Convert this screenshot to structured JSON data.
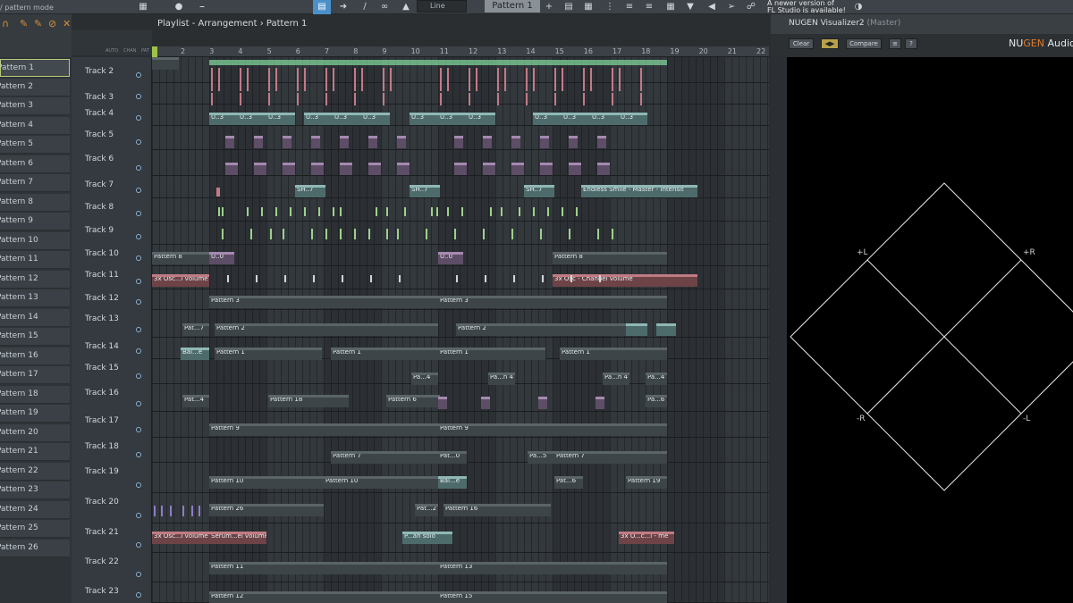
{
  "toolbar": {
    "hint": "/ pattern mode",
    "line_label": "Line",
    "pattern_selector": "Pattern 1",
    "news_line1": "A newer version of",
    "news_line2": "FL Studio is available!"
  },
  "pattern_list": [
    "Pattern 1",
    "Pattern 2",
    "Pattern 3",
    "Pattern 4",
    "Pattern 5",
    "Pattern 6",
    "Pattern 7",
    "Pattern 8",
    "Pattern 9",
    "Pattern 10",
    "Pattern 11",
    "Pattern 12",
    "Pattern 13",
    "Pattern 14",
    "Pattern 15",
    "Pattern 16",
    "Pattern 17",
    "Pattern 18",
    "Pattern 19",
    "Pattern 20",
    "Pattern 21",
    "Pattern 22",
    "Pattern 23",
    "Pattern 24",
    "Pattern 25",
    "Pattern 26"
  ],
  "playlist": {
    "title": "Playlist - Arrangement › Pattern 1",
    "tool_labels": [
      "AUTO",
      "CHAN",
      "PAT"
    ],
    "ruler": [
      "2",
      "3",
      "4",
      "5",
      "6",
      "7",
      "8",
      "9",
      "10",
      "11",
      "12",
      "13",
      "14",
      "15",
      "16",
      "17",
      "18",
      "19",
      "20",
      "21",
      "22"
    ],
    "tracks": [
      "Track 2",
      "Track 3",
      "Track 4",
      "Track 5",
      "Track 6",
      "Track 7",
      "Track 8",
      "Track 9",
      "Track 10",
      "Track 11",
      "Track 12",
      "Track 13",
      "Track 14",
      "Track 15",
      "Track 16",
      "Track 17",
      "Track 18",
      "Track 19",
      "Track 20",
      "Track 21",
      "Track 22",
      "Track 23"
    ],
    "clip_labels": {
      "u3": "U..3",
      "sh7": "SH..7",
      "endless": "Endless Smile - Master - Intensit",
      "pattern8": "Pattern 8",
      "u0": "U..0",
      "osc_vol": "3x Osc...l volume",
      "osc_ch": "3x Osc - Channel volume",
      "pattern3": "Pattern 3",
      "pat7": "Pat...7",
      "pattern2": "Pattern 2",
      "bal_e": "Bal...e",
      "pattern1": "Pattern 1",
      "pa4": "Pa...4",
      "pan4": "Pa...n 4",
      "pat4": "Pat...4",
      "pattern18": "Pattern 18",
      "pattern6": "Pattern 6",
      "pa6": "Pa...6",
      "pattern9": "Pattern 9",
      "pattern7": "Pattern 7",
      "pat0": "Pat...0",
      "pa5": "Pa...5",
      "pattern10": "Pattern 10",
      "pat6": "Pat...6",
      "pattern19": "Pattern 19",
      "pattern26": "Pattern 26",
      "pat2": "Pat...2",
      "pattern16": "Pattern 16",
      "serum": "Serum...el volume",
      "pan_solo": "P...an solo",
      "osc_me": "3x O...c...l - me",
      "pattern11": "Pattern 11",
      "pattern13": "Pattern 13",
      "pattern12": "Pattern 12",
      "pattern15": "Pattern 15"
    }
  },
  "visualizer": {
    "title": "NUGEN Visualizer2",
    "title_suffix": "(Master)",
    "clear": "Clear",
    "compare": "Compare",
    "brand_prefix": "NU",
    "brand_mid": "GEN",
    "brand_suffix": " Audio",
    "axis": {
      "plus_l": "+L",
      "plus_r": "+R",
      "minus_r": "-R",
      "minus_l": "-L"
    }
  }
}
